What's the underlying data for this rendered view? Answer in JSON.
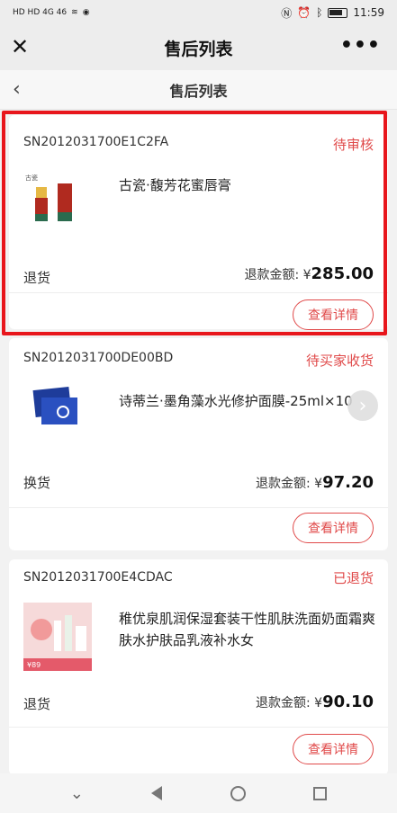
{
  "status_bar": {
    "left_glyphs": "HD HD 4G 46",
    "time": "11:59"
  },
  "wechat_header": {
    "title": "售后列表"
  },
  "page_nav": {
    "title": "售后列表"
  },
  "orders": [
    {
      "sn": "SN2012031700E1C2FA",
      "status": "待审核",
      "product_name": "古瓷·馥芳花蜜唇膏",
      "type": "退货",
      "refund_label": "退款金额: ¥",
      "refund_amount": "285.00",
      "detail_label": "查看详情",
      "thumb_icon": "lipstick-image"
    },
    {
      "sn": "SN2012031700DE00BD",
      "status": "待买家收货",
      "product_name": "诗蒂兰·墨角藻水光修护面膜-25ml×10",
      "type": "换货",
      "refund_label": "退款金额: ¥",
      "refund_amount": "97.20",
      "detail_label": "查看详情",
      "thumb_icon": "mask-image"
    },
    {
      "sn": "SN2012031700E4CDAC",
      "status": "已退货",
      "product_name": "稚优泉肌润保湿套装干性肌肤洗面奶面霜爽肤水护肤品乳液补水女",
      "type": "退货",
      "refund_label": "退款金额: ¥",
      "refund_amount": "90.10",
      "detail_label": "查看详情",
      "thumb_icon": "skincare-set-image"
    }
  ],
  "colors": {
    "accent": "#e04a4a",
    "highlight": "#e8161c"
  }
}
